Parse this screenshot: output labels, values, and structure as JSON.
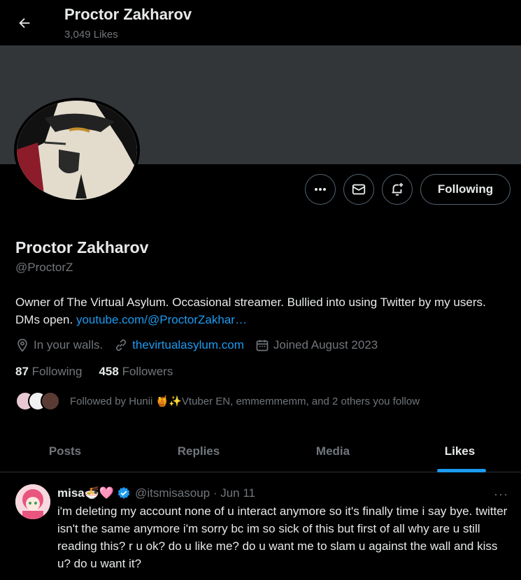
{
  "topbar": {
    "title": "Proctor Zakharov",
    "subtitle": "3,049 Likes"
  },
  "profile": {
    "name": "Proctor Zakharov",
    "handle": "@ProctorZ",
    "bio_text": "Owner of The Virtual Asylum. Occasional streamer. Bullied into using Twitter by my users. DMs open. ",
    "bio_link": "youtube.com/@ProctorZakhar…",
    "location": "In your walls.",
    "website": "thevirtualasylum.com",
    "joined": "Joined August 2023",
    "following_count": "87",
    "following_label": "Following",
    "followers_count": "458",
    "followers_label": "Followers",
    "followed_by": "Followed by Hunii 🍯✨Vtuber EN, emmemmemm, and 2 others you follow",
    "follow_button": "Following"
  },
  "tabs": [
    {
      "label": "Posts"
    },
    {
      "label": "Replies"
    },
    {
      "label": "Media"
    },
    {
      "label": "Likes"
    }
  ],
  "active_tab": "Likes",
  "post": {
    "author_name": "misa🍜🩷",
    "author_handle": "@itsmisasoup · Jun 11",
    "more": "···",
    "text": "i'm deleting my account none of u interact anymore so it's finally time i say bye. twitter isn't the same anymore i'm sorry bc im so sick of this but first of all why are u still reading this? r u ok? do u like me? do u want me to slam u against the wall and kiss u? do u want it?"
  },
  "colors": {
    "accent": "#1d9bf0",
    "muted": "#71767b",
    "text": "#e7e9ea",
    "banner": "#333639",
    "verified": "#1d9bf0"
  }
}
